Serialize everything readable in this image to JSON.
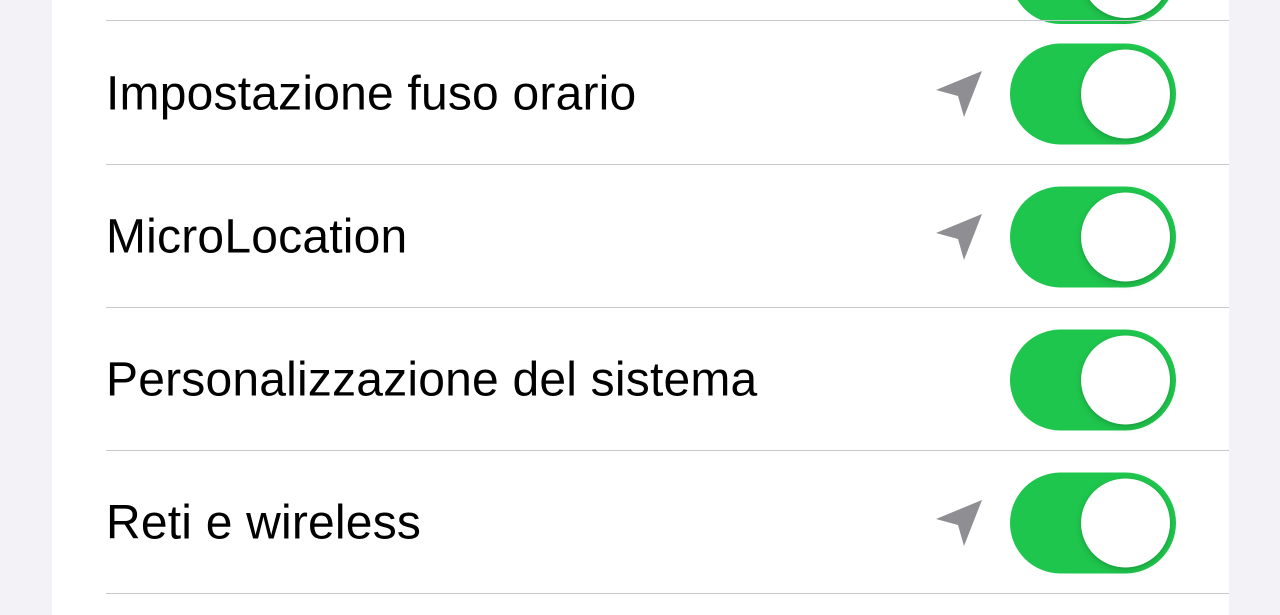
{
  "colors": {
    "background": "#f2f2f7",
    "card": "#ffffff",
    "toggle_on": "#1fc64d",
    "separator": "#c8c8cc",
    "location_icon": "#8e8e93"
  },
  "rows": [
    {
      "label": "Impostazione fuso orario",
      "location_icon": "location-arrow-icon",
      "toggle_on": true
    },
    {
      "label": "MicroLocation",
      "location_icon": "location-arrow-icon",
      "toggle_on": true
    },
    {
      "label": "Personalizzazione del sistema",
      "location_icon": null,
      "toggle_on": true
    },
    {
      "label": "Reti e wireless",
      "location_icon": "location-arrow-icon",
      "toggle_on": true
    }
  ]
}
